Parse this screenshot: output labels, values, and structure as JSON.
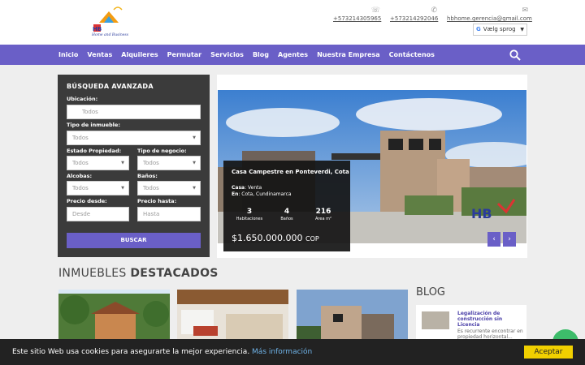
{
  "header": {
    "phone1": "+573214305965",
    "phone2": "+573214292046",
    "email": "hbhome.gerencia@gmail.com",
    "translate_label": "Vælg sprog",
    "logo_text": "Home and Business"
  },
  "nav": {
    "items": [
      "Inicio",
      "Ventas",
      "Alquileres",
      "Permutar",
      "Servicios",
      "Blog",
      "Agentes",
      "Nuestra Empresa",
      "Contáctenos"
    ]
  },
  "search": {
    "title": "BÚSQUEDA AVANZADA",
    "ubicacion_label": "Ubicación:",
    "ubicacion_placeholder": "Todos",
    "tipo_inmueble_label": "Tipo de inmueble:",
    "tipo_inmueble_value": "Todos",
    "estado_label": "Estado Propiedad:",
    "estado_value": "Todos",
    "negocio_label": "Tipo de negocio:",
    "negocio_value": "Todos",
    "alcobas_label": "Alcobas:",
    "alcobas_value": "Todos",
    "banos_label": "Baños:",
    "banos_value": "Todos",
    "precio_desde_label": "Precio desde:",
    "precio_desde_placeholder": "Desde",
    "precio_hasta_label": "Precio hasta:",
    "precio_hasta_placeholder": "Hasta",
    "button": "BUSCAR"
  },
  "featured": {
    "title": "Casa Campestre en Ponteverdi, Cota",
    "tipo_label": "Casa",
    "tipo_value": ": Venta",
    "en_label": "En",
    "en_value": ": Cota, Cundinamarca",
    "habitaciones": "3",
    "habitaciones_label": "Habitaciones",
    "banos": "4",
    "banos_label": "Baños",
    "area": "216",
    "area_label": "Area m²",
    "price": "$1.650.000.000",
    "currency": "COP",
    "prev": "‹",
    "next": "›"
  },
  "destacados": {
    "title_light": "INMUEBLES ",
    "title_bold": "DESTACADOS"
  },
  "blog": {
    "title": "BLOG",
    "post_title": "Legalización de construcción sin Licencia",
    "post_excerpt": "Es recurrente encontrar en propiedad horizontal..."
  },
  "cookie": {
    "message": "Este sitio Web usa cookies para asegurarte la mejor experiencia. ",
    "more": "Más información",
    "accept": "Aceptar"
  },
  "colors": {
    "nav": "#6a5fc7",
    "panel": "#3b3b3b",
    "accept": "#f1d000"
  }
}
